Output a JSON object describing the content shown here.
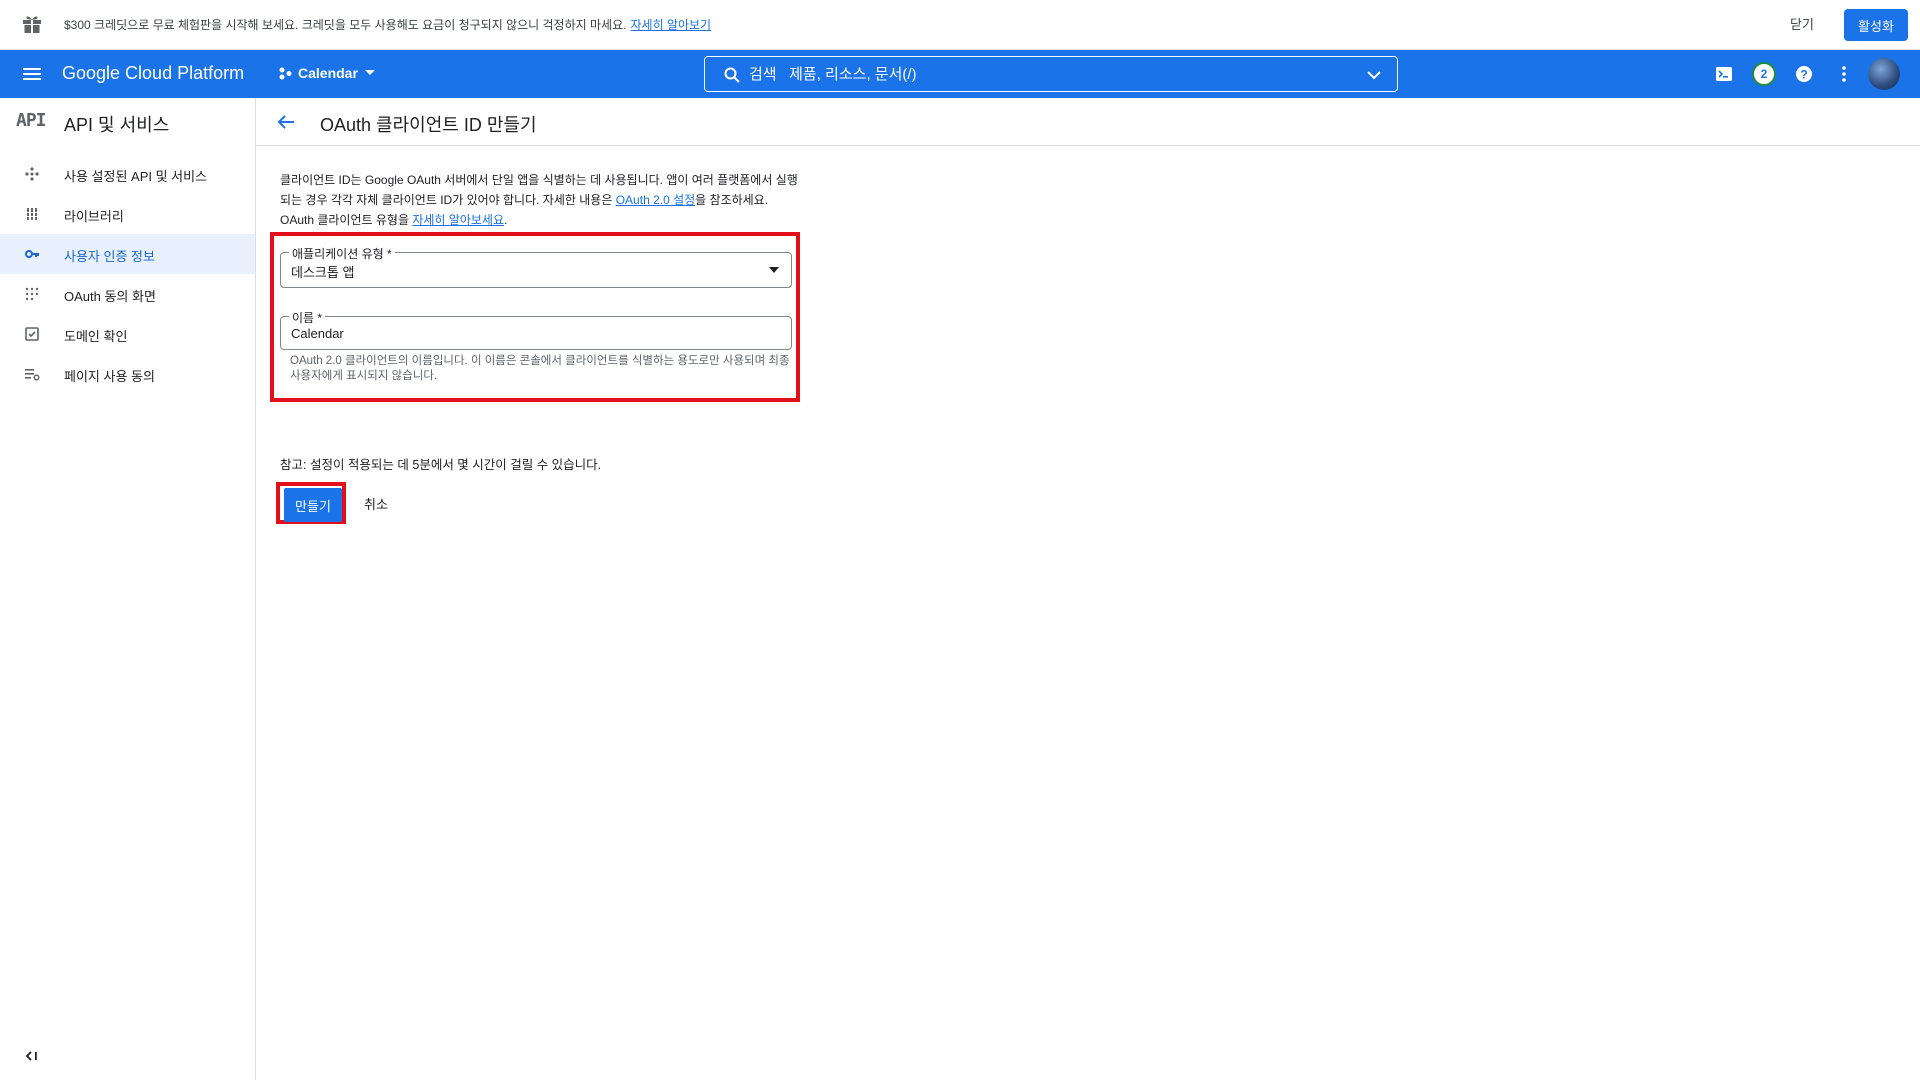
{
  "promo": {
    "text": "$300 크레딧으로 무료 체험판을 시작해 보세요. 크레딧을 모두 사용해도 요금이 청구되지 않으니 걱정하지 마세요.",
    "link": "자세히 알아보기",
    "close_label": "닫기",
    "activate_label": "활성화"
  },
  "header": {
    "logo": "Google Cloud Platform",
    "project": "Calendar",
    "search_placeholder": "검색   제품, 리소스, 문서(/)",
    "notifications_count": "2",
    "brand_color": "#1a73e8"
  },
  "sidebar": {
    "badge": "API",
    "title": "API 및 서비스",
    "items": [
      {
        "label": "사용 설정된 API 및 서비스",
        "icon": "apis-icon"
      },
      {
        "label": "라이브러리",
        "icon": "library-icon"
      },
      {
        "label": "사용자 인증 정보",
        "icon": "key-icon",
        "active": true
      },
      {
        "label": "OAuth 동의 화면",
        "icon": "consent-icon"
      },
      {
        "label": "도메인 확인",
        "icon": "checkbox-icon"
      },
      {
        "label": "페이지 사용 동의",
        "icon": "settings-list-icon"
      }
    ]
  },
  "main": {
    "title": "OAuth 클라이언트 ID 만들기",
    "intro_1": "클라이언트 ID는 Google OAuth 서버에서 단일 앱을 식별하는 데 사용됩니다. 앱이 여러 플랫폼에서 실행되는 경우 각각 자체 클라이언트 ID가 있어야 합니다. 자세한 내용은 ",
    "intro_link_1": "OAuth 2.0 설정",
    "intro_2": "을 참조하세요. OAuth 클라이언트 유형을 ",
    "intro_link_2": "자세히 알아보세요",
    "intro_3": ".",
    "app_type_label": "애플리케이션 유형 *",
    "app_type_value": "데스크톱 앱",
    "name_label": "이름 *",
    "name_value": "Calendar",
    "name_hint": "OAuth 2.0 클라이언트의 이름입니다. 이 이름은 콘솔에서 클라이언트를 식별하는 용도로만 사용되며 최종 사용자에게 표시되지 않습니다.",
    "note": "참고: 설정이 적용되는 데 5분에서 몇 시간이 걸릴 수 있습니다.",
    "create_label": "만들기",
    "cancel_label": "취소"
  }
}
